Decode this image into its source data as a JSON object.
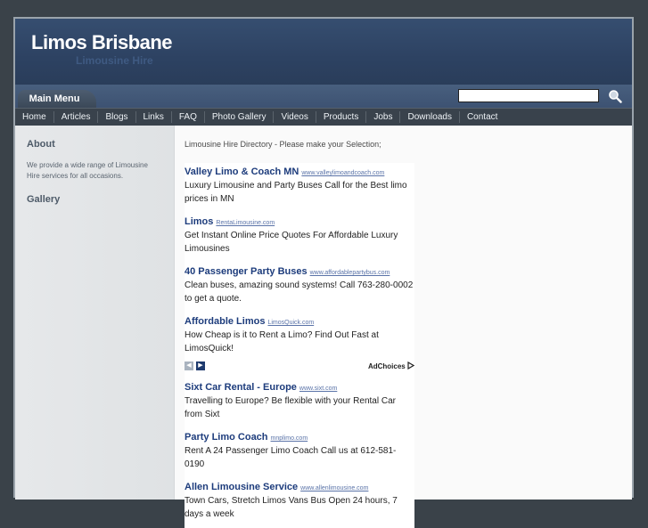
{
  "site": {
    "title": "Limos Brisbane",
    "subtitle": "Limousine Hire"
  },
  "menubar": {
    "tab_label": "Main Menu",
    "search_value": ""
  },
  "nav": {
    "items": [
      "Home",
      "Articles",
      "Blogs",
      "Links",
      "FAQ",
      "Photo Gallery",
      "Videos",
      "Products",
      "Jobs",
      "Downloads",
      "Contact"
    ]
  },
  "sidebar": {
    "about_heading": "About",
    "about_text": "We provide a wide range of Limousine Hire services for all occasions.",
    "gallery_heading": "Gallery"
  },
  "main": {
    "intro": "Limousine Hire Directory - Please make your Selection;"
  },
  "ads": {
    "group1": [
      {
        "title": "Valley Limo & Coach MN",
        "url": "www.valleylimoandcoach.com",
        "desc": "Luxury Limousine and Party Buses Call for the Best limo prices in MN"
      },
      {
        "title": "Limos",
        "url": "RentaLimousine.com",
        "desc": "Get Instant Online Price Quotes For Affordable Luxury Limousines"
      },
      {
        "title": "40 Passenger Party Buses",
        "url": "www.affordablepartybus.com",
        "desc": "Clean buses, amazing sound systems! Call 763-280-0002 to get a quote."
      },
      {
        "title": "Affordable Limos",
        "url": "LimosQuick.com",
        "desc": "How Cheap is it to Rent a Limo? Find Out Fast at LimosQuick!"
      }
    ],
    "adchoices_label": "AdChoices",
    "group2": [
      {
        "title": "Sixt Car Rental - Europe",
        "url": "www.sixt.com",
        "desc": "Travelling to Europe? Be flexible with your Rental Car from Sixt"
      },
      {
        "title": "Party Limo Coach",
        "url": "mnplimo.com",
        "desc": "Rent A 24 Passenger Limo Coach Call us at 612-581-0190"
      },
      {
        "title": "Allen Limousine Service",
        "url": "www.allenlimousine.com",
        "desc": "Town Cars, Stretch Limos Vans Bus Open 24 hours, 7 days a week"
      }
    ]
  },
  "colors": {
    "page_bg": "#3a4249",
    "header_bg": "#2d4262",
    "navbar_bg": "#39424c",
    "ad_title": "#1d3c7c",
    "ad_url": "#5a73a8"
  },
  "icons": {
    "search": "magnifier-icon",
    "prev": "chevron-left-icon",
    "next": "chevron-right-icon",
    "adchoices": "adchoices-triangle-icon"
  }
}
